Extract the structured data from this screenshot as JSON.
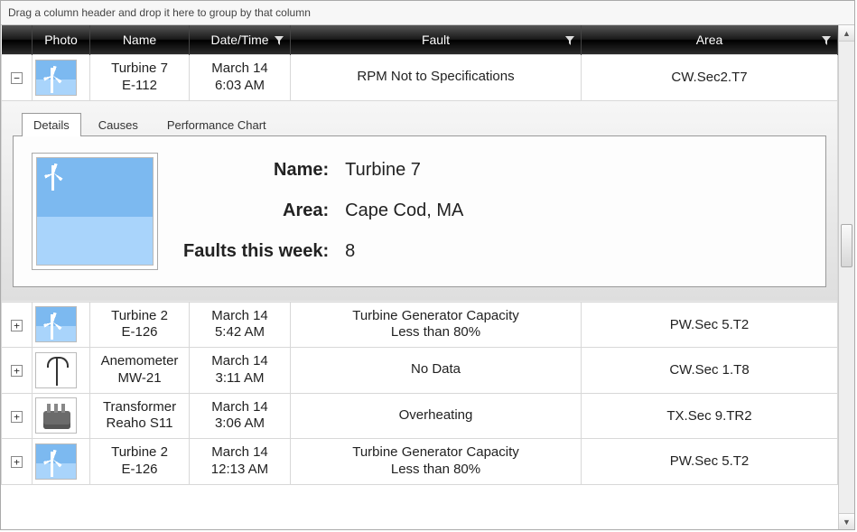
{
  "group_bar": "Drag a column header and drop it here to group by that column",
  "columns": {
    "expand": "",
    "photo": "Photo",
    "name": "Name",
    "datetime": "Date/Time",
    "fault": "Fault",
    "area": "Area"
  },
  "rows": [
    {
      "expanded": true,
      "photo_kind": "turbine",
      "name_line1": "Turbine 7",
      "name_line2": "E-112",
      "dt_line1": "March 14",
      "dt_line2": "6:03 AM",
      "fault": "RPM Not to Specifications",
      "area": "CW.Sec2.T7"
    },
    {
      "expanded": false,
      "photo_kind": "turbine",
      "name_line1": "Turbine 2",
      "name_line2": "E-126",
      "dt_line1": "March 14",
      "dt_line2": "5:42 AM",
      "fault": "Turbine Generator Capacity\nLess than 80%",
      "area": "PW.Sec 5.T2"
    },
    {
      "expanded": false,
      "photo_kind": "anemometer",
      "name_line1": "Anemometer",
      "name_line2": "MW-21",
      "dt_line1": "March 14",
      "dt_line2": "3:11 AM",
      "fault": "No Data",
      "area": "CW.Sec 1.T8"
    },
    {
      "expanded": false,
      "photo_kind": "transformer",
      "name_line1": "Transformer",
      "name_line2": "Reaho S11",
      "dt_line1": "March 14",
      "dt_line2": "3:06 AM",
      "fault": "Overheating",
      "area": "TX.Sec 9.TR2"
    },
    {
      "expanded": false,
      "photo_kind": "turbine",
      "name_line1": "Turbine 2",
      "name_line2": "E-126",
      "dt_line1": "March 14",
      "dt_line2": "12:13 AM",
      "fault": "Turbine Generator Capacity\nLess than 80%",
      "area": "PW.Sec 5.T2"
    }
  ],
  "detail": {
    "tabs": {
      "details": "Details",
      "causes": "Causes",
      "perf": "Performance Chart"
    },
    "active_tab": "details",
    "labels": {
      "name": "Name:",
      "area": "Area:",
      "faults": "Faults this week:"
    },
    "values": {
      "name": "Turbine 7",
      "area": "Cape Cod, MA",
      "faults": "8"
    },
    "photo_kind": "turbine"
  }
}
